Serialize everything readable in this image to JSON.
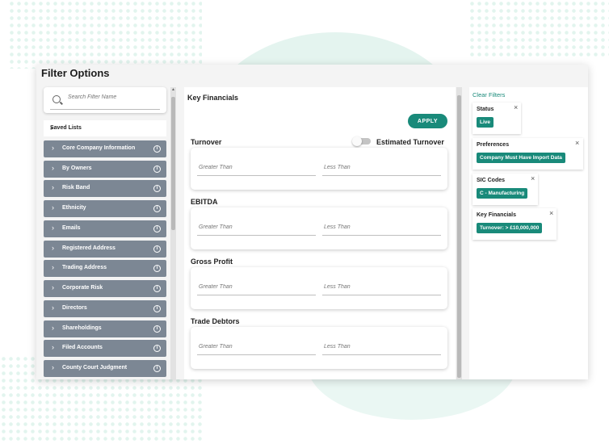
{
  "window": {
    "title": "Filter Options"
  },
  "search": {
    "placeholder": "Search Filter Name"
  },
  "saved_lists": {
    "label": "Saved Lists"
  },
  "categories": [
    "Core Company Information",
    "By Owners",
    "Risk Band",
    "Ethnicity",
    "Emails",
    "Registered Address",
    "Trading Address",
    "Corporate Risk",
    "Directors",
    "Shareholdings",
    "Filed Accounts",
    "County Court Judgment"
  ],
  "panel": {
    "title": "Key Financials",
    "apply_label": "APPLY",
    "estimated_turnover_label": "Estimated Turnover",
    "estimated_turnover_on": false,
    "sections": [
      {
        "label": "Turnover",
        "greater_placeholder": "Greater Than",
        "less_placeholder": "Less Than"
      },
      {
        "label": "EBITDA",
        "greater_placeholder": "Greater Than",
        "less_placeholder": "Less Than"
      },
      {
        "label": "Gross Profit",
        "greater_placeholder": "Greater Than",
        "less_placeholder": "Less Than"
      },
      {
        "label": "Trade Debtors",
        "greater_placeholder": "Greater Than",
        "less_placeholder": "Less Than"
      }
    ]
  },
  "active_filters": {
    "clear_label": "Clear Filters",
    "items": [
      {
        "title": "Status",
        "value": "Live"
      },
      {
        "title": "Preferences",
        "value": "Company Must Have Import Data"
      },
      {
        "title": "SIC Codes",
        "value": "C - Manufacturing"
      },
      {
        "title": "Key Financials",
        "value": "Turnover: > £10,000,000"
      }
    ],
    "remove_icon": "×"
  },
  "icons": {
    "chevron": "›",
    "info": "i",
    "scroll_up": "▲"
  },
  "colors": {
    "accent": "#198a7a",
    "category_bg": "#7c8794"
  }
}
